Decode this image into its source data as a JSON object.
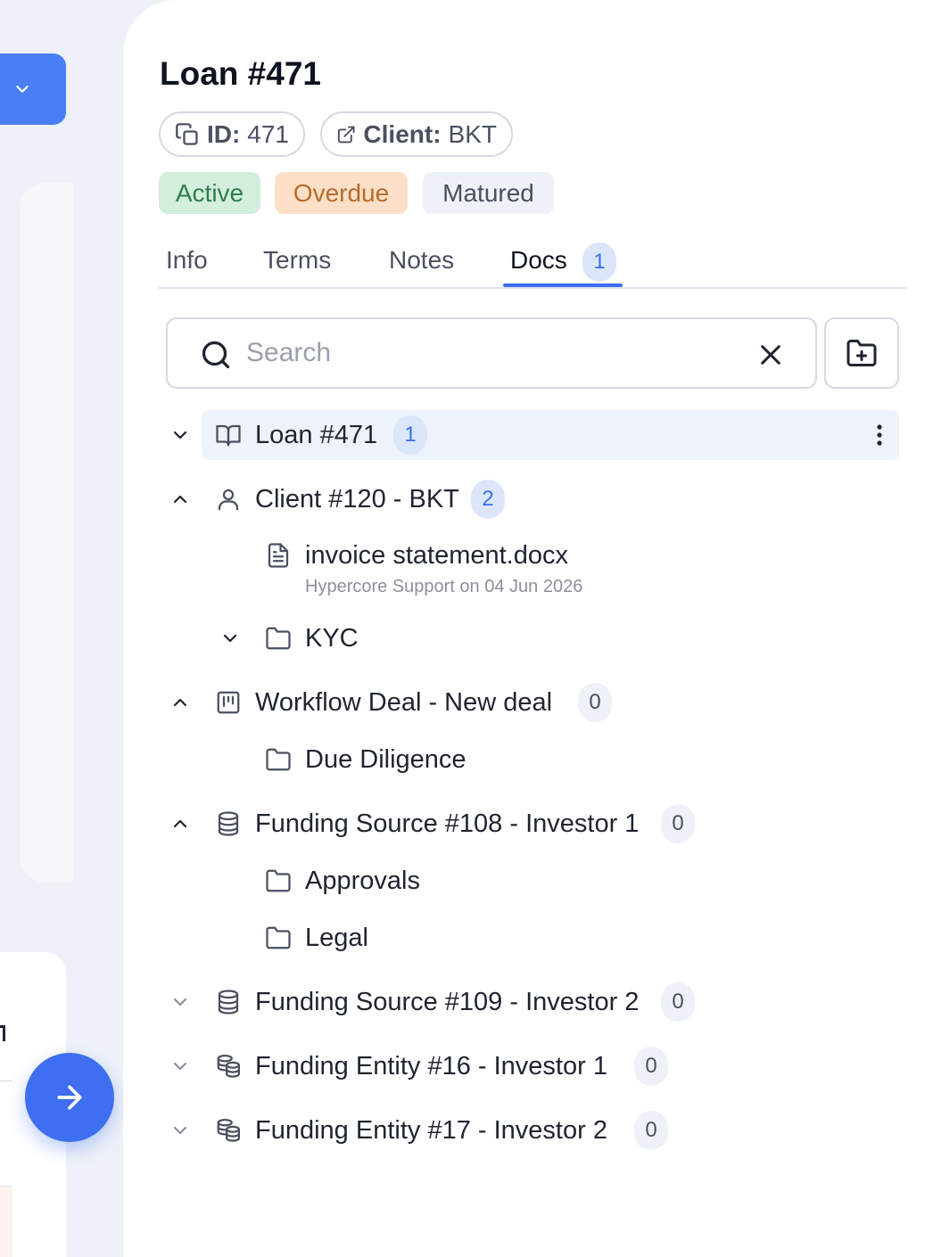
{
  "header": {
    "title": "Loan #471",
    "id_key": "ID:",
    "id_value": "471",
    "client_key": "Client:",
    "client_value": "BKT"
  },
  "statuses": [
    "Active",
    "Overdue",
    "Matured"
  ],
  "tabs": [
    {
      "label": "Info"
    },
    {
      "label": "Terms"
    },
    {
      "label": "Notes"
    },
    {
      "label": "Docs",
      "count": "1",
      "active": true
    }
  ],
  "search": {
    "placeholder": "Search",
    "value": ""
  },
  "tree": {
    "loan": {
      "label": "Loan #471",
      "count": "1"
    },
    "client": {
      "label": "Client #120 - BKT",
      "count": "2"
    },
    "file": {
      "name": "invoice statement.docx",
      "meta": "Hypercore Support on 04 Jun 2026"
    },
    "kyc": {
      "label": "KYC"
    },
    "workflow": {
      "label": "Workflow Deal - New deal",
      "count": "0"
    },
    "due_diligence": {
      "label": "Due Diligence"
    },
    "fs108": {
      "label": "Funding Source #108 - Investor 1",
      "count": "0"
    },
    "approvals": {
      "label": "Approvals"
    },
    "legal": {
      "label": "Legal"
    },
    "fs109": {
      "label": "Funding Source #109 - Investor 2",
      "count": "0"
    },
    "fe16": {
      "label": "Funding Entity #16 - Investor 1",
      "count": "0"
    },
    "fe17": {
      "label": "Funding Entity #17 - Investor 2",
      "count": "0"
    }
  },
  "colors": {
    "accent": "#3d6ff0",
    "active_bg": "#d4eedd",
    "overdue_bg": "#fbe0c7",
    "matured_bg": "#eef1f8"
  },
  "icons": [
    "chevron-down-icon",
    "copy-icon",
    "external-link-icon",
    "search-icon",
    "close-icon",
    "folder-plus-icon",
    "book-icon",
    "user-icon",
    "file-text-icon",
    "folder-icon",
    "kanban-icon",
    "database-icon",
    "coins-icon",
    "more-vertical-icon",
    "arrow-right-icon"
  ]
}
